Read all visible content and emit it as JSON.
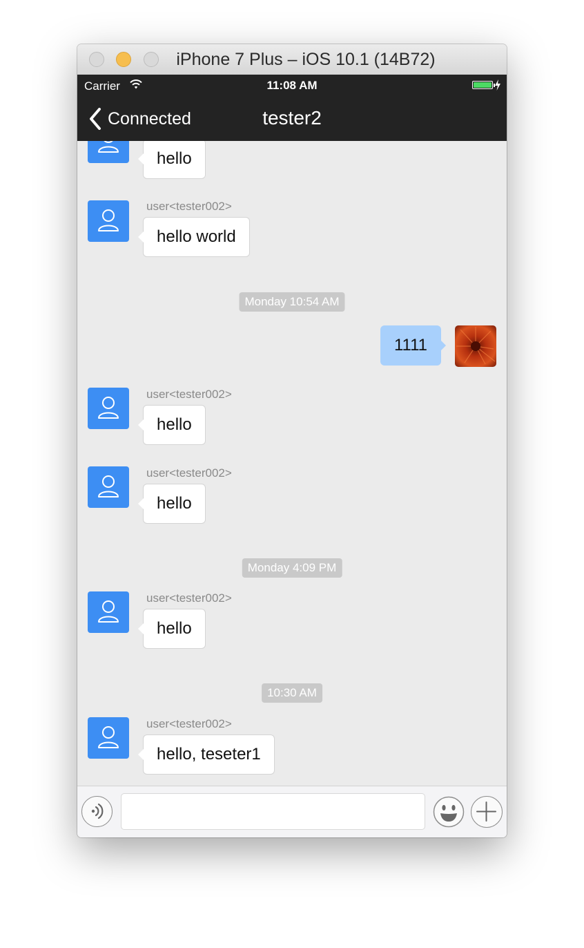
{
  "window": {
    "title": "iPhone 7 Plus – iOS 10.1 (14B72)"
  },
  "status_bar": {
    "carrier": "Carrier",
    "time": "11:08 AM"
  },
  "nav": {
    "back_label": "Connected",
    "title": "tester2"
  },
  "messages": [
    {
      "sender": "",
      "text": "hello"
    },
    {
      "sender": "user<tester002>",
      "text": "hello world"
    },
    {
      "timestamp": "Monday 10:54 AM"
    },
    {
      "text": "1111"
    },
    {
      "sender": "user<tester002>",
      "text": "hello"
    },
    {
      "sender": "user<tester002>",
      "text": "hello"
    },
    {
      "timestamp": "Monday 4:09 PM"
    },
    {
      "sender": "user<tester002>",
      "text": "hello"
    },
    {
      "timestamp": "10:30 AM"
    },
    {
      "sender": "user<tester002>",
      "text": "hello, teseter1"
    }
  ],
  "input": {
    "value": "",
    "placeholder": ""
  },
  "colors": {
    "accent": "#3d8ef3",
    "outgoing_bubble": "#a8d0fc",
    "bar": "#232323",
    "battery": "#4cd964"
  },
  "icons": [
    "wifi-icon",
    "battery-icon",
    "bolt-icon",
    "back-chevron-icon",
    "user-avatar-icon",
    "voice-icon",
    "emoji-icon",
    "plus-icon"
  ]
}
